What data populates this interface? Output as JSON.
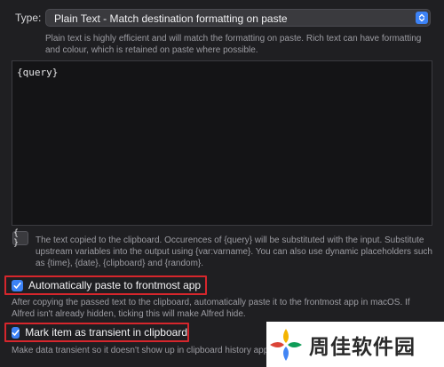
{
  "type_field": {
    "label": "Type:",
    "selected": "Plain Text - Match destination formatting on paste"
  },
  "type_help": "Plain text is highly efficient and will match the formatting on paste. Rich text can have formatting and colour, which is retained on paste where possible.",
  "editor": {
    "value": "{query}"
  },
  "editor_help": {
    "button_label": "{ }",
    "text": "The text copied to the clipboard. Occurences of {query} will be substituted with the input. Substitute upstream variables into the output using {var:varname}. You can also use dynamic placeholders such as {time}, {date}, {clipboard} and {random}."
  },
  "auto_paste": {
    "label": "Automatically paste to frontmost app",
    "checked": true,
    "help": "After copying the passed text to the clipboard, automatically paste it to the frontmost app in macOS. If Alfred isn't already hidden, ticking this will make Alfred hide."
  },
  "transient": {
    "label": "Mark item as transient in clipboard",
    "checked": true,
    "help": "Make data transient so it doesn't show up in clipboard history app"
  },
  "watermark": {
    "text": "周佳软件园"
  },
  "colors": {
    "background": "#1f1f22",
    "accent": "#3c82f6",
    "highlight_box": "#d6262c"
  }
}
